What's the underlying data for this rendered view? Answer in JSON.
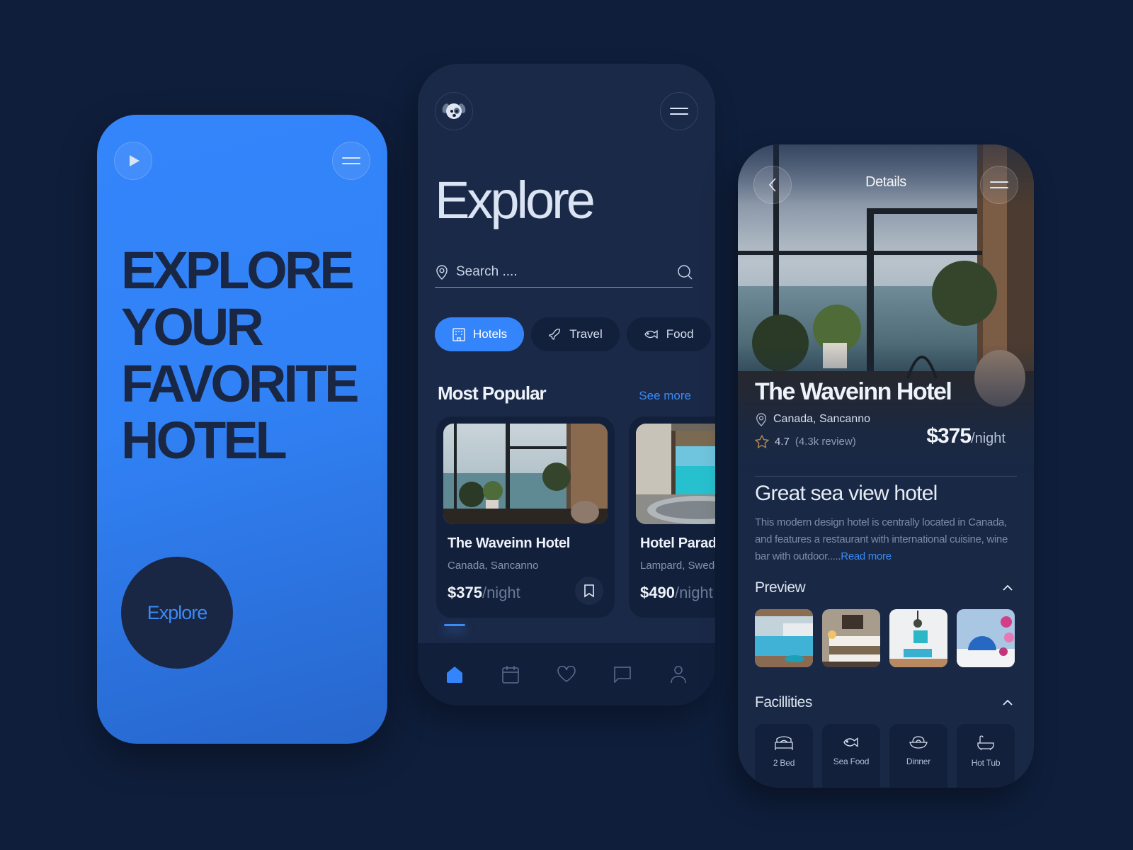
{
  "colors": {
    "background": "#0f1e3b",
    "accent": "#3485fb",
    "phone_dark": "#1b2948",
    "card": "#13203b",
    "heading_dark": "#1a2744"
  },
  "splash": {
    "heading_lines": [
      "EXPLORE",
      "YOUR",
      "FAVORITE",
      "HOTEL"
    ],
    "explore_button": "Explore",
    "icons": {
      "left": "play-icon",
      "right": "menu-icon"
    }
  },
  "explore": {
    "title": "Explore",
    "search": {
      "placeholder": "Search ....",
      "value": ""
    },
    "categories": [
      {
        "label": "Hotels",
        "icon": "hotel-icon",
        "active": true
      },
      {
        "label": "Travel",
        "icon": "airplane-icon",
        "active": false
      },
      {
        "label": "Food",
        "icon": "fish-icon",
        "active": false
      }
    ],
    "section_title": "Most Popular",
    "see_more": "See more",
    "hotels": [
      {
        "name": "The Waveinn Hotel",
        "location": "Canada, Sancanno",
        "price": "$375",
        "unit": "/night"
      },
      {
        "name": "Hotel Paradise",
        "location": "Lampard, Sweden",
        "price": "$490",
        "unit": "/night"
      }
    ],
    "nav": [
      "home",
      "calendar",
      "favorites",
      "messages",
      "profile"
    ],
    "active_nav": "home"
  },
  "details": {
    "title": "Details",
    "hotel_name": "The Waveinn Hotel",
    "location": "Canada, Sancanno",
    "rating": "4.7",
    "reviews": "(4.3k review)",
    "price": "$375",
    "unit": "/night",
    "headline": "Great sea view hotel",
    "description": "This modern design hotel is centrally located in Canada, and features a restaurant with international cuisine, wine bar with outdoor.....",
    "read_more": "Read more",
    "preview_title": "Preview",
    "preview_images": [
      "pool-photo",
      "bedroom-photo",
      "living-room-photo",
      "santorini-dome-photo"
    ],
    "facilities_title": "Facillities",
    "facilities": [
      {
        "label": "2 Bed",
        "icon": "bed-icon"
      },
      {
        "label": "Sea Food",
        "icon": "fish-icon"
      },
      {
        "label": "Dinner",
        "icon": "dinner-bowl-icon"
      },
      {
        "label": "Hot Tub",
        "icon": "bathtub-icon"
      }
    ]
  }
}
